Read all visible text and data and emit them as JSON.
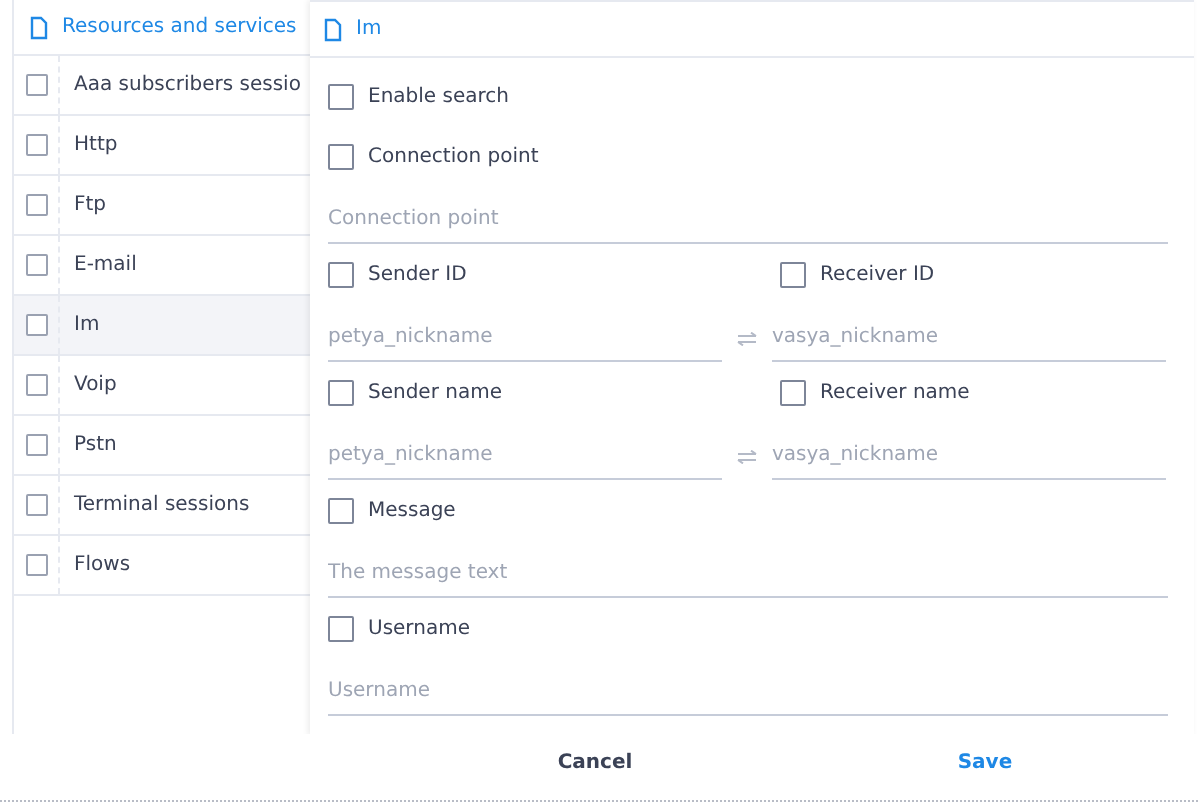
{
  "sidebar": {
    "title": "Resources and services",
    "items": [
      {
        "label": "Aaa subscribers sessio",
        "checked": false,
        "selected": false
      },
      {
        "label": "Http",
        "checked": false,
        "selected": false
      },
      {
        "label": "Ftp",
        "checked": false,
        "selected": false
      },
      {
        "label": "E-mail",
        "checked": false,
        "selected": false
      },
      {
        "label": "Im",
        "checked": false,
        "selected": true
      },
      {
        "label": "Voip",
        "checked": false,
        "selected": false
      },
      {
        "label": "Pstn",
        "checked": false,
        "selected": false
      },
      {
        "label": "Terminal sessions",
        "checked": false,
        "selected": false
      },
      {
        "label": "Flows",
        "checked": false,
        "selected": false
      }
    ]
  },
  "panel": {
    "title": "Im",
    "form": [
      {
        "kind": "checkbox",
        "label": "Enable search",
        "checked": false
      },
      {
        "kind": "checkbox",
        "label": "Connection point",
        "checked": false
      },
      {
        "kind": "field",
        "placeholder": "Connection point"
      },
      {
        "kind": "checkbox-pair",
        "items": [
          {
            "label": "Sender ID",
            "checked": false
          },
          {
            "label": "Receiver ID",
            "checked": false
          }
        ]
      },
      {
        "kind": "field-pair",
        "placeholders": [
          "petya_nickname",
          "vasya_nickname"
        ]
      },
      {
        "kind": "checkbox-pair",
        "items": [
          {
            "label": "Sender name",
            "checked": false
          },
          {
            "label": "Receiver name",
            "checked": false
          }
        ]
      },
      {
        "kind": "field-pair",
        "placeholders": [
          "petya_nickname",
          "vasya_nickname"
        ]
      },
      {
        "kind": "checkbox",
        "label": "Message",
        "checked": false
      },
      {
        "kind": "field",
        "placeholder": "The message text"
      },
      {
        "kind": "checkbox",
        "label": "Username",
        "checked": false
      },
      {
        "kind": "field",
        "placeholder": "Username"
      }
    ]
  },
  "footer": {
    "buttons": [
      {
        "label": "Cancel",
        "kind": "secondary"
      },
      {
        "label": "Save",
        "kind": "primary"
      }
    ]
  }
}
